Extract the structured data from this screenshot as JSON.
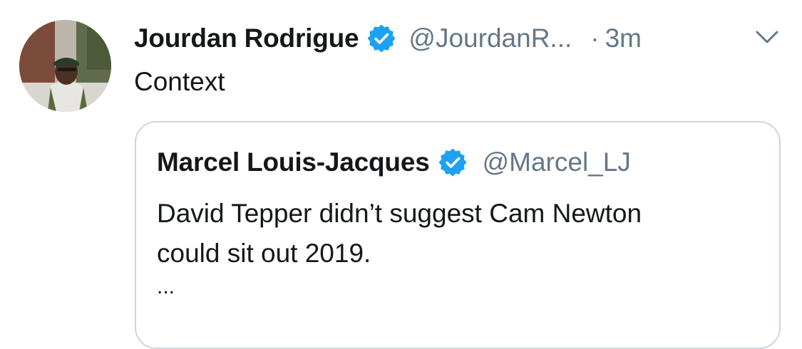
{
  "tweet": {
    "display_name": "Jourdan Rodrigue",
    "handle": "@JourdanR...",
    "separator": "·",
    "time": "3m",
    "text": "Context",
    "verified_icon": "verified-badge-icon",
    "menu_icon": "chevron-down-icon",
    "accent_color": "#1da1f2"
  },
  "quote": {
    "display_name": "Marcel Louis-Jacques",
    "handle": "@Marcel_LJ",
    "text_line1": "David Tepper didn’t suggest Cam Newton",
    "text_line2": "could sit out 2019.",
    "ellipsis": "..."
  }
}
